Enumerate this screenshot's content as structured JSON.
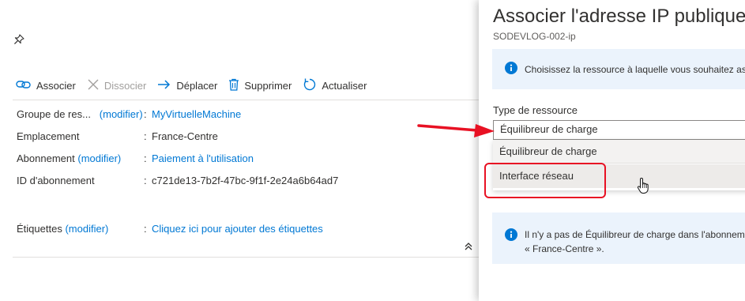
{
  "toolbar": {
    "associate": "Associer",
    "dissociate": "Dissocier",
    "move": "Déplacer",
    "delete": "Supprimer",
    "refresh": "Actualiser"
  },
  "properties": {
    "resource_group": {
      "key": "Groupe de res...",
      "modify": "(modifier)",
      "value": "MyVirtuelleMachine"
    },
    "location": {
      "key": "Emplacement",
      "value": "France-Centre"
    },
    "subscription": {
      "key": "Abonnement",
      "modify": "(modifier)",
      "value": "Paiement à l'utilisation"
    },
    "subscription_id": {
      "key": "ID d'abonnement",
      "value": "c721de13-7b2f-47bc-9f1f-2e24a6b64ad7"
    },
    "tags": {
      "key": "Étiquettes",
      "modify": "(modifier)",
      "value": "Cliquez ici pour ajouter des étiquettes"
    },
    "colon": ":"
  },
  "panel": {
    "title": "Associer l'adresse IP publique",
    "subtitle": "SODEVLOG-002-ip",
    "info_top": "Choisissez la ressource à laquelle vous souhaitez associer",
    "field_label": "Type de ressource",
    "dropdown_value": "Équilibreur de charge",
    "options": [
      "Équilibreur de charge",
      "Interface réseau"
    ],
    "info_bottom_line1": "Il n'y a pas de Équilibreur de charge dans l'abonnement",
    "info_bottom_line2": "« France-Centre »."
  },
  "colors": {
    "accent": "#0078d4",
    "annotation_red": "#e81123",
    "info_background": "#ebf3fc"
  },
  "icons": [
    "pin-icon",
    "link-icon",
    "close-icon",
    "arrow-right-icon",
    "trash-icon",
    "refresh-icon",
    "chevron-up-double-icon",
    "info-icon",
    "hand-cursor-icon"
  ]
}
